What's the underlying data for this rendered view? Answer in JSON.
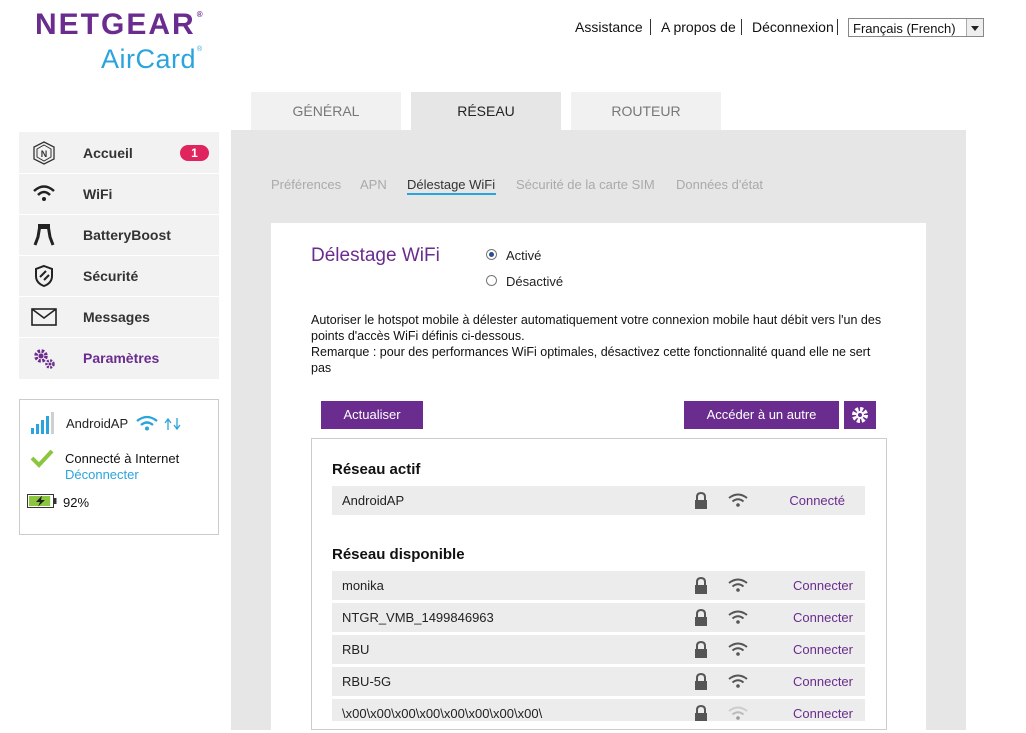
{
  "brand": {
    "name": "NETGEAR",
    "product": "AirCard"
  },
  "header": {
    "links": [
      "Assistance",
      "A propos de",
      "Déconnexion"
    ],
    "language": "Français (French)"
  },
  "main_tabs": [
    {
      "label": "GÉNÉRAL",
      "active": false
    },
    {
      "label": "RÉSEAU",
      "active": true
    },
    {
      "label": "ROUTEUR",
      "active": false
    }
  ],
  "sidebar": {
    "items": [
      {
        "label": "Accueil",
        "icon": "netgear-logo-icon",
        "badge": "1"
      },
      {
        "label": "WiFi",
        "icon": "wifi-icon"
      },
      {
        "label": "BatteryBoost",
        "icon": "battery-boost-clamp-icon"
      },
      {
        "label": "Sécurité",
        "icon": "shield-icon"
      },
      {
        "label": "Messages",
        "icon": "envelope-icon"
      },
      {
        "label": "Paramètres",
        "icon": "gears-icon"
      }
    ]
  },
  "status": {
    "network_name": "AndroidAP",
    "connection_text": "Connecté à Internet",
    "disconnect_link": "Déconnecter",
    "battery_percent": "92%",
    "battery_level": 0.92,
    "signal_bars": 4
  },
  "subtabs": [
    {
      "label": "Préférences",
      "active": false
    },
    {
      "label": "APN",
      "active": false
    },
    {
      "label": "Délestage WiFi",
      "active": true
    },
    {
      "label": "Sécurité de la carte SIM",
      "active": false
    },
    {
      "label": "Données d'état",
      "active": false
    }
  ],
  "offload": {
    "title": "Délestage WiFi",
    "options": [
      {
        "label": "Activé",
        "selected": true
      },
      {
        "label": "Désactivé",
        "selected": false
      }
    ],
    "description_line1": "Autoriser le hotspot mobile à délester automatiquement votre connexion mobile haut débit vers l'un des points d'accès WiFi définis ci-dessous.",
    "description_line2": "Remarque : pour des performances WiFi optimales, désactivez cette fonctionnalité quand elle ne sert pas",
    "refresh_button": "Actualiser",
    "other_button": "Accéder à un autre",
    "active_heading": "Réseau actif",
    "available_heading": "Réseau disponible",
    "active_network": {
      "name": "AndroidAP",
      "action": "Connecté"
    },
    "available_networks": [
      {
        "name": "monika",
        "action": "Connecter",
        "signal": "strong"
      },
      {
        "name": "NTGR_VMB_1499846963",
        "action": "Connecter",
        "signal": "strong"
      },
      {
        "name": "RBU",
        "action": "Connecter",
        "signal": "strong"
      },
      {
        "name": "RBU-5G",
        "action": "Connecter",
        "signal": "strong"
      },
      {
        "name": "\\x00\\x00\\x00\\x00\\x00\\x00\\x00\\x00\\",
        "action": "Connecter",
        "signal": "weak"
      }
    ]
  },
  "colors": {
    "brand_purple": "#6a2c8e",
    "accent_blue": "#2aa4dc",
    "badge_red": "#e0245e",
    "ok_green": "#8cc63f"
  }
}
